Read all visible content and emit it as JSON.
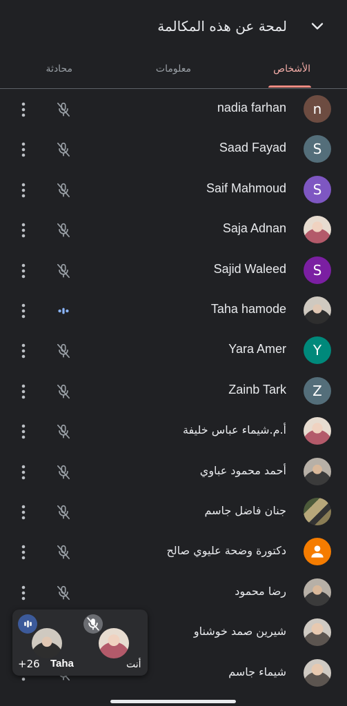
{
  "header": {
    "title": "لمحة عن هذه المكالمة"
  },
  "tabs": [
    {
      "label": "الأشخاص",
      "active": true
    },
    {
      "label": "معلومات",
      "active": false
    },
    {
      "label": "محادثة",
      "active": false
    }
  ],
  "participants": [
    {
      "name": "nadia farhan",
      "avatar": "n",
      "avatar_color": "#6d4c41",
      "mic": "muted"
    },
    {
      "name": "Saad Fayad",
      "avatar": "S",
      "avatar_color": "#546e7a",
      "mic": "muted"
    },
    {
      "name": "Saif Mahmoud",
      "avatar": "S",
      "avatar_color": "#7e57c2",
      "mic": "muted"
    },
    {
      "name": "Saja Adnan",
      "avatar": "",
      "avatar_color": "",
      "mic": "muted"
    },
    {
      "name": "Sajid Waleed",
      "avatar": "S",
      "avatar_color": "#7b1fa2",
      "mic": "muted"
    },
    {
      "name": "Taha hamode",
      "avatar": "",
      "avatar_color": "",
      "mic": "speaking"
    },
    {
      "name": "Yara Amer",
      "avatar": "Y",
      "avatar_color": "#00897b",
      "mic": "muted"
    },
    {
      "name": "Zainb Tark",
      "avatar": "Z",
      "avatar_color": "#546e7a",
      "mic": "muted"
    },
    {
      "name": "أ.م.شيماء عباس خليفة",
      "avatar": "",
      "avatar_color": "",
      "mic": "muted"
    },
    {
      "name": "أحمد محمود عباوي",
      "avatar": "",
      "avatar_color": "",
      "mic": "muted"
    },
    {
      "name": "جنان فاضل جاسم",
      "avatar": "",
      "avatar_color": "",
      "mic": "muted"
    },
    {
      "name": "دكتورة وضحة عليوي صالح",
      "avatar": "",
      "avatar_color": "#f57c00",
      "mic": "muted"
    },
    {
      "name": "رضا محمود",
      "avatar": "",
      "avatar_color": "",
      "mic": "muted"
    },
    {
      "name": "شيرين صمد خوشناو",
      "avatar": "",
      "avatar_color": "",
      "mic": "muted"
    },
    {
      "name": "شيماء جاسم",
      "avatar": "",
      "avatar_color": "",
      "mic": "muted"
    }
  ],
  "pip": {
    "speaker_name": "Taha",
    "extra_count": "+26",
    "self_label": "أنت"
  },
  "colors": {
    "background": "#202124",
    "accent_tab": "#f28b82",
    "speaking": "#8ab4f8"
  },
  "icons": {
    "collapse": "chevron-down-icon",
    "mic_muted": "mic-off-icon",
    "speaking": "audio-level-icon",
    "more": "more-vert-icon",
    "default_avatar": "person-icon"
  }
}
